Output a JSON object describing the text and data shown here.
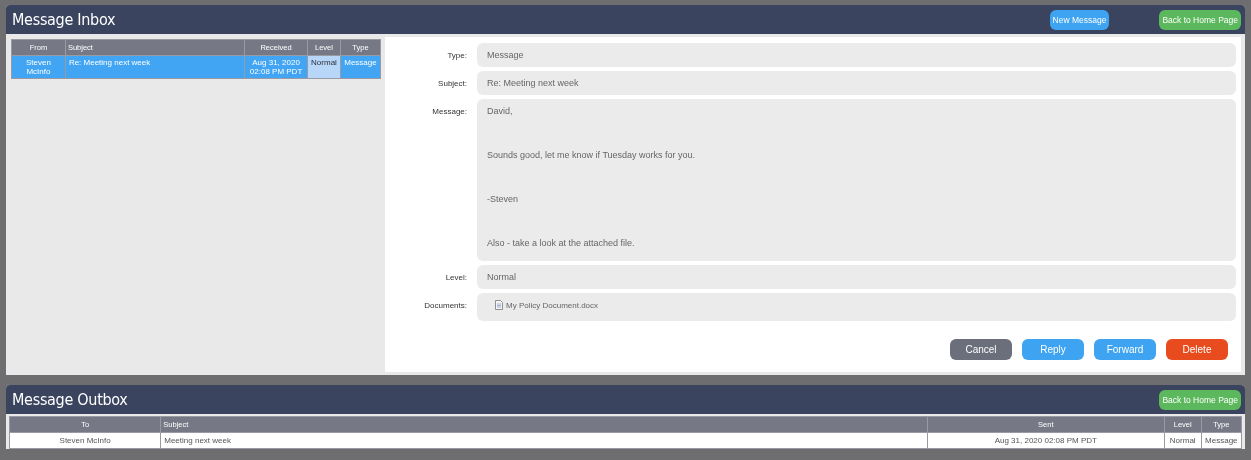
{
  "inbox": {
    "title": "Message Inbox",
    "header_buttons": [
      {
        "label": "New Message",
        "kind": "primary"
      },
      {
        "label": "Back to Home Page",
        "kind": "success"
      }
    ],
    "table": {
      "columns": [
        {
          "label": "From",
          "highlighted": false
        },
        {
          "label": "Subject",
          "highlighted": false
        },
        {
          "label": "Received",
          "highlighted": false
        },
        {
          "label": "Level",
          "highlighted": true
        },
        {
          "label": "Type",
          "highlighted": false
        }
      ],
      "rows": [
        {
          "selected": true,
          "cells": [
            "Steven McInfo",
            "Re: Meeting next week",
            "Aug 31, 2020 02:08 PM PDT",
            "Normal",
            "Message"
          ]
        }
      ]
    },
    "detail": {
      "fields": [
        {
          "label": "Type:",
          "kind": "text",
          "value": "Message"
        },
        {
          "label": "Subject:",
          "kind": "text",
          "value": "Re: Meeting next week"
        },
        {
          "label": "Message:",
          "kind": "message",
          "paragraphs": [
            "David,",
            "Sounds good, let me know if Tuesday works for you.",
            "-Steven",
            "Also - take a look at the attached file."
          ]
        },
        {
          "label": "Level:",
          "kind": "text",
          "value": "Normal"
        },
        {
          "label": "Documents:",
          "kind": "documents",
          "files": [
            "My Policy Document.docx"
          ]
        }
      ],
      "buttons": [
        {
          "label": "Cancel",
          "kind": "secondary"
        },
        {
          "label": "Reply",
          "kind": "primary"
        },
        {
          "label": "Forward",
          "kind": "primary"
        },
        {
          "label": "Delete",
          "kind": "danger"
        }
      ]
    }
  },
  "outbox": {
    "title": "Message Outbox",
    "header_buttons": [
      {
        "label": "Back to Home Page",
        "kind": "success"
      }
    ],
    "table": {
      "columns": [
        "To",
        "Subject",
        "Sent",
        "Level",
        "Type"
      ],
      "rows": [
        [
          "Steven McInfo",
          "Meeting next week",
          "Aug 31, 2020 02:08 PM PDT",
          "Normal",
          "Message"
        ]
      ]
    }
  }
}
